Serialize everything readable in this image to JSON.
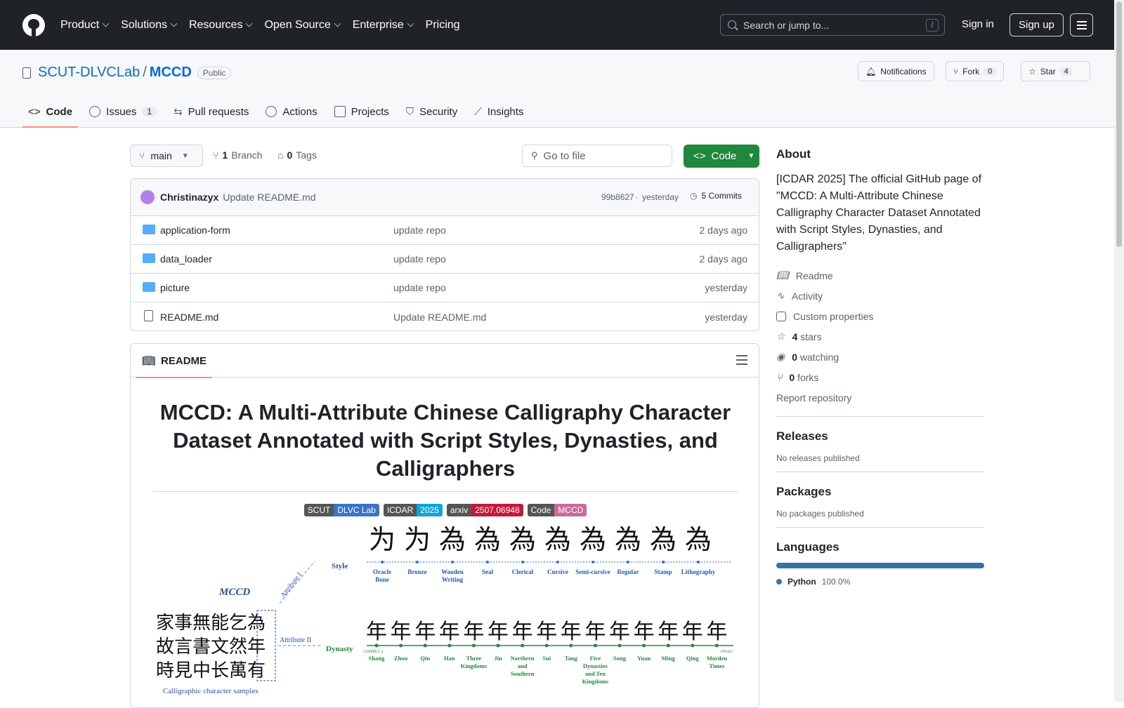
{
  "global_nav": {
    "items": [
      "Product",
      "Solutions",
      "Resources",
      "Open Source",
      "Enterprise",
      "Pricing"
    ],
    "search_placeholder": "Search or jump to...",
    "search_shortcut": "/",
    "sign_in": "Sign in",
    "sign_up": "Sign up"
  },
  "repo": {
    "owner": "SCUT-DLVCLab",
    "separator": "/",
    "name": "MCCD",
    "visibility": "Public",
    "notifications_label": "Notifications",
    "fork_label": "Fork",
    "fork_count": "0",
    "star_label": "Star",
    "star_count": "4"
  },
  "tabs": [
    {
      "label": "Code",
      "active": true,
      "icon": "code-icon"
    },
    {
      "label": "Issues",
      "count": "1",
      "icon": "issue-icon"
    },
    {
      "label": "Pull requests",
      "icon": "pull-request-icon"
    },
    {
      "label": "Actions",
      "icon": "play-icon"
    },
    {
      "label": "Projects",
      "icon": "table-icon"
    },
    {
      "label": "Security",
      "icon": "shield-icon"
    },
    {
      "label": "Insights",
      "icon": "graph-icon"
    }
  ],
  "branch": {
    "current": "main",
    "branch_count": "1",
    "branch_label": "Branch",
    "tag_count": "0",
    "tag_label": "Tags",
    "go_to_file": "Go to file",
    "code_button": "Code"
  },
  "latest_commit": {
    "author": "Christinazyx",
    "message": "Update README.md",
    "hash": "99b8627",
    "dot": "·",
    "time": "yesterday",
    "commits_label": "5 Commits"
  },
  "files": [
    {
      "name": "application-form",
      "type": "folder",
      "message": "update repo",
      "date": "2 days ago"
    },
    {
      "name": "data_loader",
      "type": "folder",
      "message": "update repo",
      "date": "2 days ago"
    },
    {
      "name": "picture",
      "type": "folder",
      "message": "update repo",
      "date": "yesterday"
    },
    {
      "name": "README.md",
      "type": "file",
      "message": "Update README.md",
      "date": "yesterday"
    }
  ],
  "readme": {
    "tab_label": "README",
    "title": "MCCD: A Multi-Attribute Chinese Calligraphy Character Dataset Annotated with Script Styles, Dynasties, and Calligraphers",
    "badges": [
      {
        "left": "SCUT",
        "right": "DLVC Lab",
        "color": "#3b73c8"
      },
      {
        "left": "ICDAR",
        "right": "2025",
        "color": "#0ea5d8"
      },
      {
        "left": "arxiv",
        "right": "2507.06948",
        "color": "#c5183a"
      },
      {
        "left": "Code",
        "right": "MCCD",
        "color": "#c86b9a"
      }
    ],
    "figure": {
      "mccd_label": "MCCD",
      "samples_caption": "Calligraphic character samples",
      "attr1": "Attribute I",
      "attr2": "Attribute II",
      "style_label": "Style",
      "dynasty_label": "Dynasty",
      "start_note": "(1600B.C.)",
      "end_note": "(Now)",
      "styles": [
        "Oracle Bone",
        "Bronze",
        "Wooden Writing",
        "Seal",
        "Clerical",
        "Cursive",
        "Semi-cursive",
        "Regular",
        "Stamp",
        "Lithography"
      ],
      "dynasties": [
        "Shang",
        "Zhou",
        "Qin",
        "Han",
        "Three Kingdoms",
        "Jin",
        "Northern and Southern",
        "Sui",
        "Tang",
        "Five Dynasties and Ten Kingdoms",
        "Song",
        "Yuan",
        "Ming",
        "Qing",
        "Morden Times"
      ],
      "sample_chars": [
        "家事無能乞為",
        "故言書文然年",
        "時見中长萬有"
      ],
      "style_chars": "为为為為為為為為為為",
      "dynasty_chars": "年年年年年年年年年年年年年年年"
    }
  },
  "about": {
    "heading": "About",
    "description": "[ICDAR 2025] The official GitHub page of \"MCCD: A Multi-Attribute Chinese Calligraphy Character Dataset Annotated with Script Styles, Dynasties, and Calligraphers\"",
    "links": [
      {
        "label": "Readme",
        "icon": "book-icon"
      },
      {
        "label": "Activity",
        "icon": "pulse-icon"
      },
      {
        "label": "Custom properties",
        "icon": "note-icon"
      },
      {
        "count": "4",
        "label": "stars",
        "icon": "star-icon"
      },
      {
        "count": "0",
        "label": "watching",
        "icon": "eye-icon"
      },
      {
        "count": "0",
        "label": "forks",
        "icon": "fork-icon"
      }
    ],
    "report": "Report repository",
    "releases_heading": "Releases",
    "releases_text": "No releases published",
    "packages_heading": "Packages",
    "packages_text": "No packages published",
    "languages_heading": "Languages",
    "language": {
      "name": "Python",
      "percent": "100.0%",
      "color": "#3572a5"
    }
  }
}
